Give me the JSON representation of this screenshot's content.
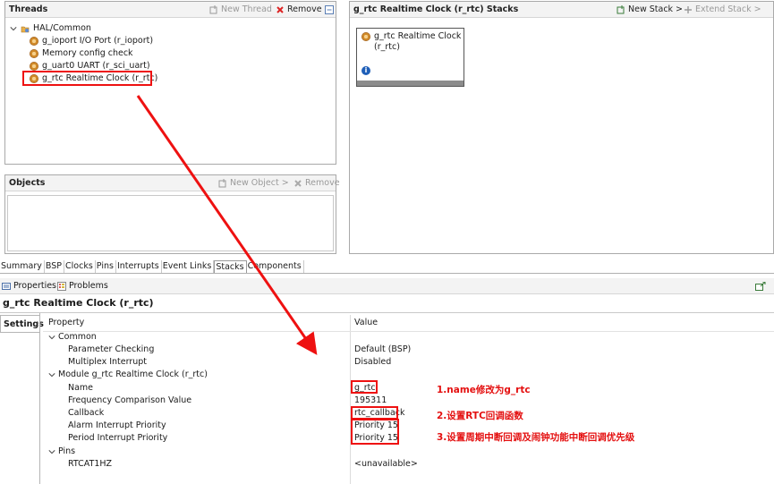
{
  "threads": {
    "title": "Threads",
    "new_thread": "New Thread",
    "remove": "Remove",
    "root": "HAL/Common",
    "items": [
      "g_ioport I/O Port (r_ioport)",
      "Memory config check",
      "g_uart0 UART (r_sci_uart)",
      "g_rtc Realtime Clock (r_rtc)"
    ]
  },
  "objects": {
    "title": "Objects",
    "new_object": "New Object >",
    "remove": "Remove"
  },
  "stacks": {
    "title": "g_rtc Realtime Clock (r_rtc) Stacks",
    "new_stack": "New Stack >",
    "extend_stack": "Extend Stack >",
    "card_line1": "g_rtc Realtime Clock",
    "card_line2": "(r_rtc)",
    "info_icon": "i"
  },
  "tabs": [
    "Summary",
    "BSP",
    "Clocks",
    "Pins",
    "Interrupts",
    "Event Links",
    "Stacks",
    "Components"
  ],
  "views": {
    "properties": "Properties",
    "problems": "Problems"
  },
  "props": {
    "title": "g_rtc Realtime Clock (r_rtc)",
    "settings": "Settings",
    "col_property": "Property",
    "col_value": "Value",
    "rows": [
      {
        "k": "Common",
        "v": ""
      },
      {
        "k": "Parameter Checking",
        "v": "Default (BSP)"
      },
      {
        "k": "Multiplex Interrupt",
        "v": "Disabled"
      },
      {
        "k": "Module g_rtc Realtime Clock (r_rtc)",
        "v": ""
      },
      {
        "k": "Name",
        "v": "g_rtc"
      },
      {
        "k": "Frequency Comparison Value",
        "v": "195311"
      },
      {
        "k": "Callback",
        "v": "rtc_callback"
      },
      {
        "k": "Alarm Interrupt Priority",
        "v": "Priority 15"
      },
      {
        "k": "Period Interrupt Priority",
        "v": "Priority 15"
      },
      {
        "k": "Pins",
        "v": ""
      },
      {
        "k": "RTCAT1HZ",
        "v": "<unavailable>"
      }
    ]
  },
  "notes": {
    "n1": "1.name修改为g_rtc",
    "n2": "2.设置RTC回调函数",
    "n3": "3.设置周期中断回调及闹钟功能中断回调优先级"
  },
  "colors": {
    "annotation": "#e41010",
    "header": "#f3f3f3",
    "border": "#a9a9a9"
  }
}
